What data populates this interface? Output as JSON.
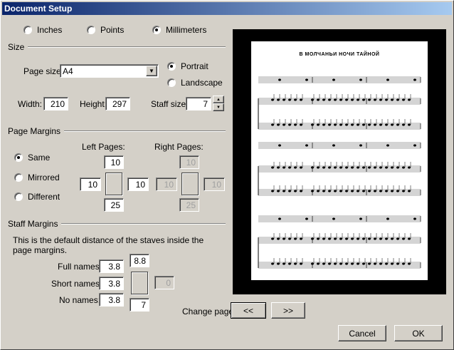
{
  "title": "Document Setup",
  "units": {
    "options": [
      "Inches",
      "Points",
      "Millimeters"
    ],
    "selected": "Millimeters"
  },
  "size": {
    "group_label": "Size",
    "page_size_label": "Page size:",
    "page_size_value": "A4",
    "orientation": {
      "options": [
        "Portrait",
        "Landscape"
      ],
      "selected": "Portrait"
    },
    "width_label": "Width:",
    "width_value": "210",
    "height_label": "Height:",
    "height_value": "297",
    "staff_size_label": "Staff size:",
    "staff_size_value": "7"
  },
  "page_margins": {
    "group_label": "Page Margins",
    "modes": [
      "Same",
      "Mirrored",
      "Different"
    ],
    "selected": "Same",
    "left_pages_label": "Left Pages:",
    "right_pages_label": "Right Pages:",
    "left": {
      "top": "10",
      "left": "10",
      "right": "10",
      "bottom": "25"
    },
    "right": {
      "top": "10",
      "left": "10",
      "right": "10",
      "bottom": "25"
    }
  },
  "staff_margins": {
    "group_label": "Staff Margins",
    "description": "This is the default distance of the staves inside the page margins.",
    "full_names_label": "Full names:",
    "full_names_value": "3.8",
    "short_names_label": "Short names:",
    "short_names_value": "3.8",
    "no_names_label": "No names:",
    "no_names_value": "3.8",
    "top_value": "8.8",
    "right_value": "0",
    "bottom_value": "7"
  },
  "preview": {
    "score_title": "В МОЛЧАНЬИ НОЧИ ТАЙНОЙ"
  },
  "change_page_label": "Change page:",
  "prev_label": "<<",
  "next_label": ">>",
  "cancel_label": "Cancel",
  "ok_label": "OK"
}
